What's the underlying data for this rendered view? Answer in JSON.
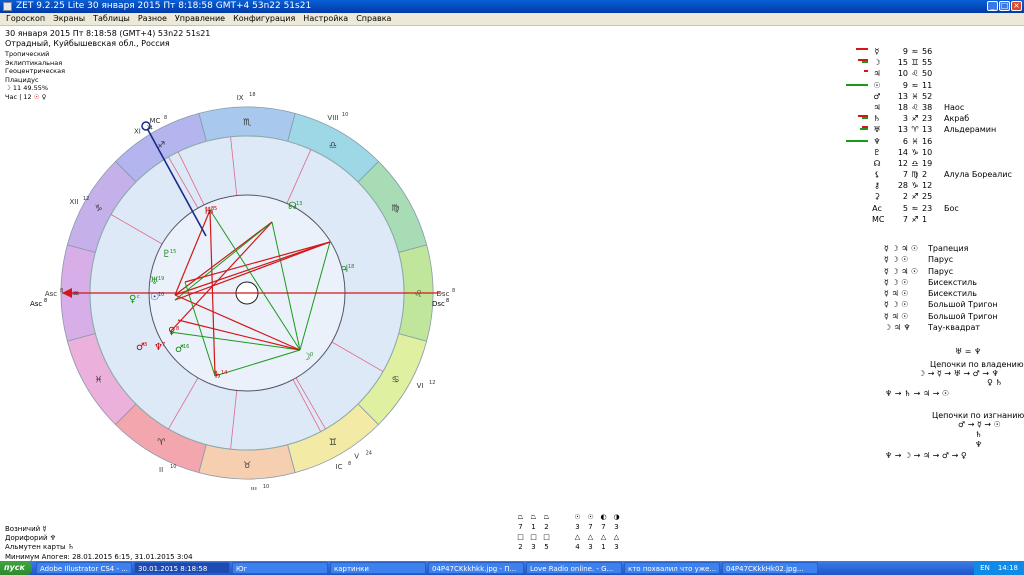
{
  "window": {
    "title": "ZET 9.2.25 Lite  30 января 2015  Пт  8:18:58 GMT+4 53n22  51s21"
  },
  "menu": [
    "Гороскоп",
    "Экраны",
    "Таблицы",
    "Разное",
    "Управление",
    "Конфигурация",
    "Настройка",
    "Справка"
  ],
  "info": {
    "line1": "30 января 2015  Пт    8:18:58  (GMT+4)  53n22  51s21",
    "line2": "Отрадный, Куйбышевская обл., Россия"
  },
  "settings": {
    "line1": "Тропический",
    "line2": "Эклиптикальная",
    "line3": "Геоцентрическая",
    "line4": "Плацидус",
    "moon_phase": "11  49.55%",
    "hour_ruler": "Час | 12"
  },
  "chart": {
    "signs": [
      "♈",
      "♉",
      "♊",
      "♋",
      "♌",
      "♍",
      "♎",
      "♏",
      "♐",
      "♑",
      "♒",
      "♓"
    ],
    "houses": [
      {
        "label": "MC",
        "sup": "8"
      },
      {
        "label": "IX",
        "sup": "18"
      },
      {
        "label": "VIII",
        "sup": "10"
      },
      {
        "label": "Dsc",
        "sup": "8"
      },
      {
        "label": "VI",
        "sup": "12"
      },
      {
        "label": "V",
        "sup": "24"
      },
      {
        "label": "IC",
        "sup": "8"
      },
      {
        "label": "III",
        "sup": "10"
      },
      {
        "label": "II",
        "sup": "10"
      },
      {
        "label": "Asc",
        "sup": "8"
      },
      {
        "label": "XII",
        "sup": "12"
      },
      {
        "label": "XI",
        "sup": "24"
      }
    ],
    "planets": [
      {
        "glyph": "☊",
        "sup": "13",
        "color": "#1a8a1a"
      },
      {
        "glyph": "♄",
        "sup": "8",
        "color": "#c00000"
      },
      {
        "glyph": "♃",
        "sup": "18",
        "color": "#1a8a1a"
      },
      {
        "glyph": "♇",
        "sup": "15",
        "color": "#1a8a1a"
      },
      {
        "glyph": "♅",
        "sup": "19",
        "color": "#1a8a1a"
      },
      {
        "glyph": "♀",
        "sup": "c",
        "color": "#1a8a1a"
      },
      {
        "glyph": "☉",
        "sup": "10",
        "color": "#1a3aa8"
      },
      {
        "glyph": "♀",
        "sup": "8",
        "color": "#c00000"
      },
      {
        "glyph": "♂",
        "sup": "3",
        "color": "#c00000"
      },
      {
        "glyph": "♆",
        "sup": "7",
        "color": "#c00000"
      },
      {
        "glyph": "♂",
        "sup": "16",
        "color": "#1a8a1a"
      },
      {
        "glyph": "♄",
        "sup": "14",
        "color": "#c00000"
      },
      {
        "glyph": "☽",
        "sup": "0",
        "color": "#1a8a1a"
      },
      {
        "glyph": "♄",
        "sup": "5",
        "color": "#c00000"
      }
    ]
  },
  "planets_list": [
    {
      "glyph": "☿",
      "deg": "9",
      "sign": "≈",
      "min": "56",
      "star": "",
      "g": 0,
      "r": 12
    },
    {
      "glyph": "☽",
      "deg": "15",
      "sign": "♊",
      "min": "55",
      "star": "",
      "g": 6,
      "r": 10
    },
    {
      "glyph": "♃",
      "deg": "10",
      "sign": "♌",
      "min": "50",
      "star": "",
      "g": 0,
      "r": 4
    },
    {
      "glyph": "☉",
      "deg": "9",
      "sign": "≈",
      "min": "11",
      "star": "",
      "g": 22,
      "r": 0
    },
    {
      "glyph": "♂",
      "deg": "13",
      "sign": "♓",
      "min": "52",
      "star": "",
      "g": 0,
      "r": 0
    },
    {
      "glyph": "♃",
      "deg": "18",
      "sign": "♌",
      "min": "38",
      "star": "Наос",
      "g": 0,
      "r": 0
    },
    {
      "glyph": "♄",
      "deg": "3",
      "sign": "♐",
      "min": "23",
      "star": "Акраб",
      "g": 6,
      "r": 10
    },
    {
      "glyph": "♅",
      "deg": "13",
      "sign": "♈",
      "min": "13",
      "star": "Альдерамин",
      "g": 8,
      "r": 6
    },
    {
      "glyph": "♆",
      "deg": "6",
      "sign": "♓",
      "min": "16",
      "star": "",
      "g": 22,
      "r": 0
    },
    {
      "glyph": "♇",
      "deg": "14",
      "sign": "♑",
      "min": "10",
      "star": "",
      "g": 0,
      "r": 0
    },
    {
      "glyph": "☊",
      "deg": "12",
      "sign": "♎",
      "min": "19",
      "star": "",
      "g": 0,
      "r": 0
    },
    {
      "glyph": "⚸",
      "deg": "7",
      "sign": "♍",
      "min": "2",
      "star": "Алула Бореалис",
      "g": 0,
      "r": 0
    },
    {
      "glyph": "⚷",
      "deg": "28",
      "sign": "♑",
      "min": "12",
      "star": "",
      "g": 0,
      "r": 0
    },
    {
      "glyph": "⚳",
      "deg": "2",
      "sign": "♐",
      "min": "25",
      "star": "",
      "g": 0,
      "r": 0
    },
    {
      "glyph": "Ac",
      "deg": "5",
      "sign": "≈",
      "min": "23",
      "star": "Бос",
      "g": 0,
      "r": 0
    },
    {
      "glyph": "MC",
      "deg": "7",
      "sign": "♐",
      "min": "1",
      "star": "",
      "g": 0,
      "r": 0
    }
  ],
  "aspects_list": [
    {
      "glyphs": "☿ ☽ ♃ ☉",
      "name": "Трапеция"
    },
    {
      "glyphs": "☿ ☽ ☉",
      "name": "Парус"
    },
    {
      "glyphs": "☿ ☽ ♃ ☉",
      "name": "Парус"
    },
    {
      "glyphs": "☿ ☽ ☉",
      "name": "Бисекстиль"
    },
    {
      "glyphs": "☿ ♃ ☉",
      "name": "Бисекстиль"
    },
    {
      "glyphs": "☿ ☽ ☉",
      "name": "Большой Тригон"
    },
    {
      "glyphs": "☿ ♃ ☉",
      "name": "Большой Тригон"
    },
    {
      "glyphs": "☽ ♃ ♆",
      "name": "Тау-квадрат"
    }
  ],
  "chains": {
    "top": "♅ = ♆",
    "title1": "Цепочки по владению",
    "line1a": "☽ → ☿ → ♅ → ♂ → ♆",
    "line1b": "♀ ♄",
    "line1c": "♆ → ♄ → ♃ → ☉",
    "title2": "Цепочки по изгнанию",
    "line2a": "♂ → ☿ → ☉",
    "line2b": "♄",
    "line2c": "♆",
    "line2d": "♆ → ☽ → ♃ → ♂ → ♀"
  },
  "bottom_left": {
    "line1": "Возничий  ☿",
    "line2": "Дорифорий  ♆",
    "line3": "Альмутен карты  ♄",
    "line4": "Минимум Апогея: 28.01.2015  6:15,  31.01.2015  3:04"
  },
  "elements_grid": {
    "row1": [
      "⏢",
      "⏢",
      "⏢",
      "",
      "☉",
      "☉",
      "◐",
      "◑"
    ],
    "row2": [
      "7",
      "1",
      "2",
      "",
      "3",
      "7",
      "7",
      "3"
    ],
    "row3": [
      "□",
      "□",
      "□",
      "",
      "△",
      "△",
      "△",
      "△"
    ],
    "row4": [
      "2",
      "3",
      "5",
      "",
      "4",
      "3",
      "1",
      "3"
    ]
  },
  "taskbar": {
    "start": "пуск",
    "tasks": [
      "Adobe Illustrator CS4 - ...",
      "30.01.2015  8:18:58",
      "Юг",
      "картинки",
      "04P47CKkkhkk.jpg - П...",
      "Love Radio online. - G...",
      "кто похвалил что уже...",
      "04P47CKkkHk02.jpg..."
    ],
    "lang": "EN",
    "clock": "14:18"
  },
  "colors": {
    "titlebar": "#0a5fd6",
    "menubar": "#ece9d8",
    "green_bar": "#1a9a1a",
    "red_bar": "#d01818",
    "inner_disc": "#dde9f7"
  }
}
